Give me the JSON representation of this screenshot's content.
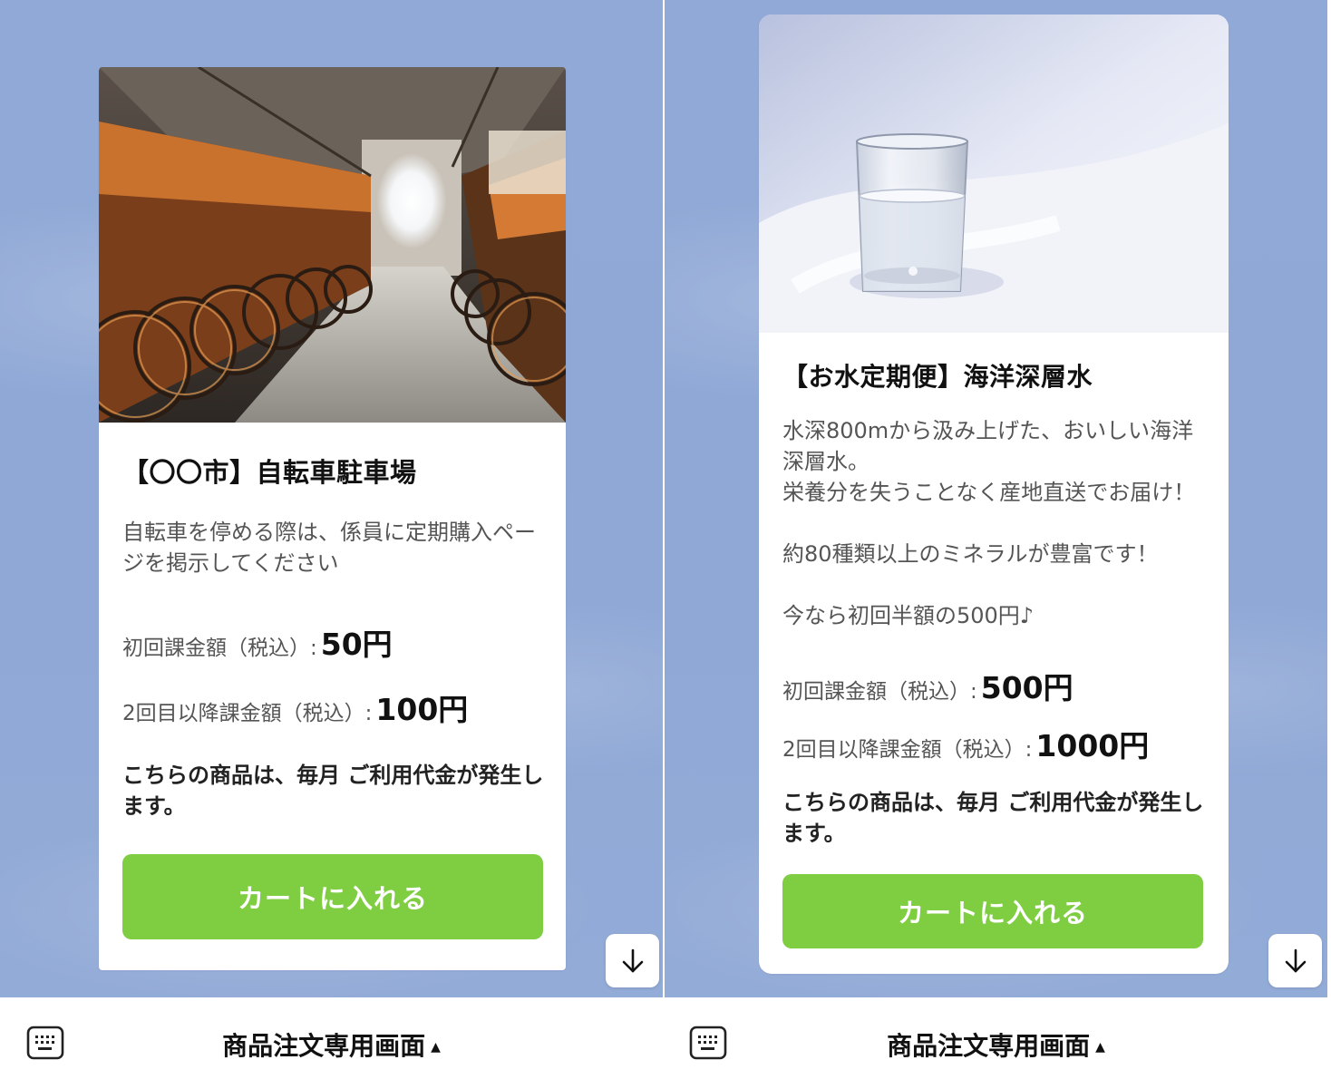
{
  "screens": [
    {
      "product": {
        "title": "【〇〇市】自転車駐車場",
        "description": "自転車を停める際は、係員に定期購入ページを掲示してください",
        "first_charge_label": "初回課金額（税込）:",
        "first_charge_value": "50円",
        "recurring_charge_label": "2回目以降課金額（税込）:",
        "recurring_charge_value": "100円",
        "notice": "こちらの商品は、毎月 ご利用代金が発生します。",
        "cart_button": "カートに入れる",
        "image": "bicycle-parking-photo"
      },
      "scroll_icon": "arrow-down-icon",
      "menu_title": "商品注文専用画面",
      "menu_caret": "▲",
      "keyboard_icon": "keyboard-icon"
    },
    {
      "product": {
        "title": "【お水定期便】海洋深層水",
        "description": "水深800mから汲み上げた、おいしい海洋深層水。\n栄養分を失うことなく産地直送でお届け！\n\n約80種類以上のミネラルが豊富です！\n\n今なら初回半額の500円♪",
        "first_charge_label": "初回課金額（税込）:",
        "first_charge_value": "500円",
        "recurring_charge_label": "2回目以降課金額（税込）:",
        "recurring_charge_value": "1000円",
        "notice": "こちらの商品は、毎月 ご利用代金が発生します。",
        "cart_button": "カートに入れる",
        "image": "glass-of-water-photo"
      },
      "scroll_icon": "arrow-down-icon",
      "menu_title": "商品注文専用画面",
      "menu_caret": "▲",
      "keyboard_icon": "keyboard-icon"
    }
  ],
  "colors": {
    "chat_background": "#8fa8d6",
    "cart_button": "#7fcd41",
    "card": "#ffffff"
  }
}
